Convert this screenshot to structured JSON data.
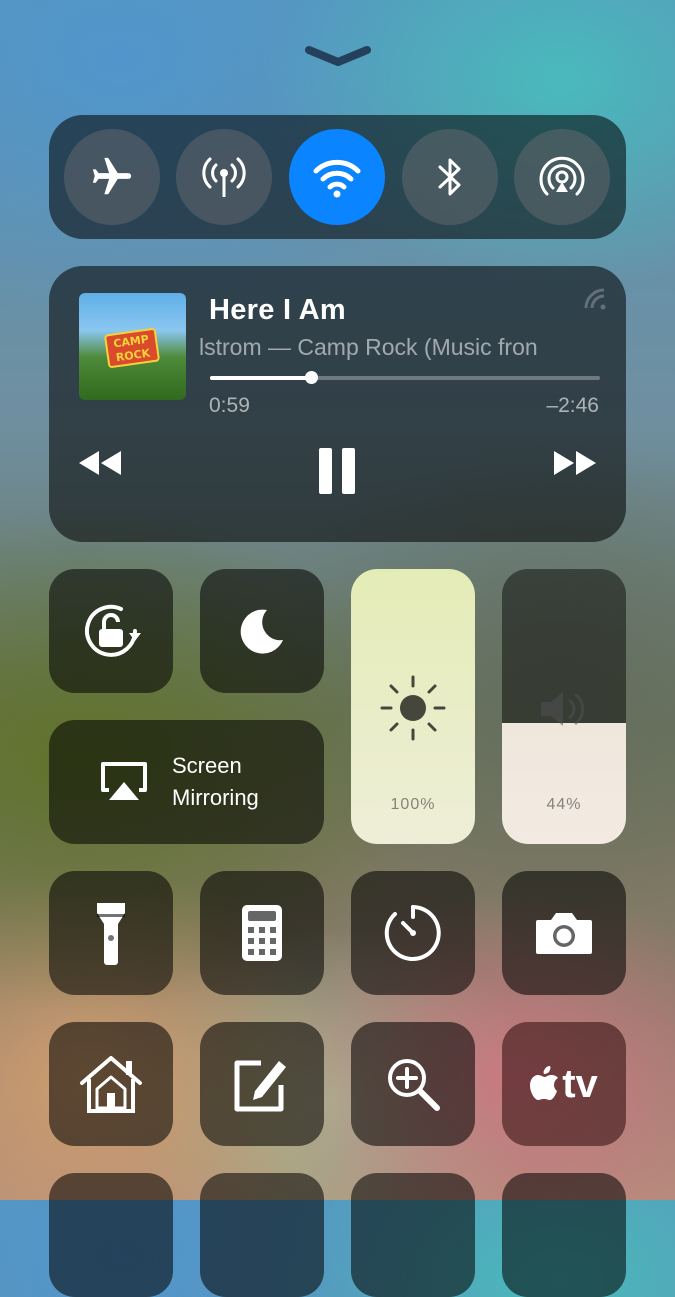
{
  "control_center": {
    "connectivity": {
      "airplane_mode": {
        "icon": "airplane-icon",
        "on": false
      },
      "cellular_data": {
        "icon": "antenna-icon",
        "on": false
      },
      "wifi": {
        "icon": "wifi-icon",
        "on": true,
        "accent": "#0a84ff"
      },
      "bluetooth": {
        "icon": "bluetooth-icon",
        "on": false
      },
      "airdrop": {
        "icon": "airdrop-icon",
        "on": false
      }
    },
    "now_playing": {
      "title": "Here I Am",
      "subtitle": "lstrom — Camp Rock (Music fron",
      "album_art_text": "CAMP ROCK",
      "elapsed": "0:59",
      "remaining": "–2:46",
      "progress": 0.26
    },
    "tiles": {
      "orientation_lock": {
        "icon": "orientation-lock-icon"
      },
      "do_not_disturb": {
        "icon": "moon-icon"
      },
      "screen_mirroring": {
        "label_line1": "Screen",
        "label_line2": "Mirroring",
        "icon": "airplay-icon"
      },
      "brightness": {
        "label": "100%",
        "level": 1.0,
        "icon": "sun-icon"
      },
      "volume": {
        "label": "44%",
        "level": 0.44,
        "icon": "speaker-icon"
      },
      "flashlight": {
        "icon": "flashlight-icon"
      },
      "calculator": {
        "icon": "calculator-icon"
      },
      "timer": {
        "icon": "timer-icon"
      },
      "camera": {
        "icon": "camera-icon"
      },
      "home": {
        "icon": "home-icon"
      },
      "notes": {
        "icon": "notes-icon"
      },
      "magnifier": {
        "icon": "magnifier-icon"
      },
      "apple_tv": {
        "label": "tv",
        "icon": "apple-tv-icon"
      }
    }
  }
}
